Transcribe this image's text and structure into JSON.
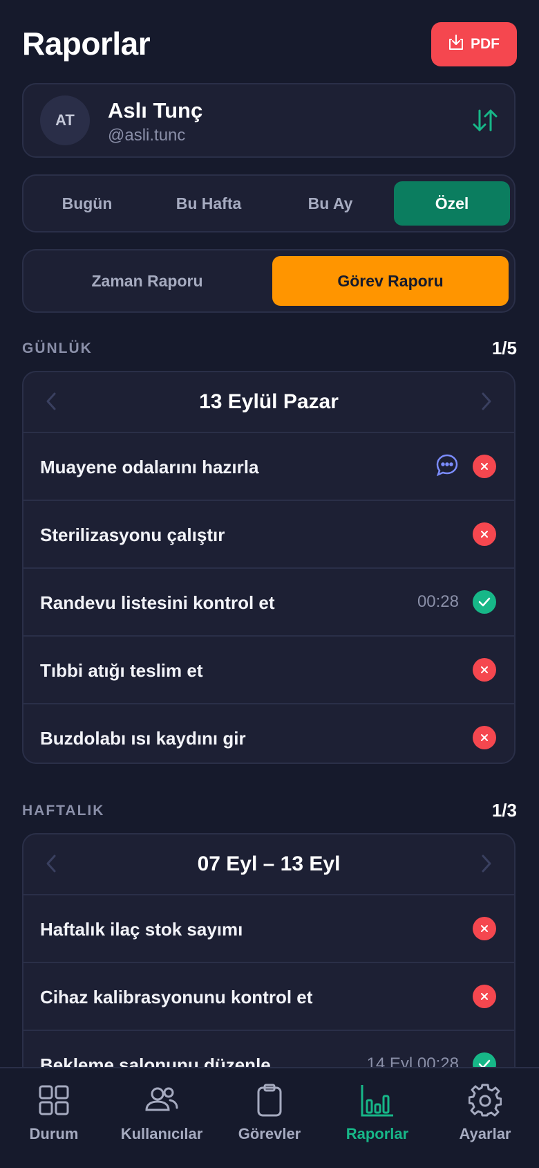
{
  "header": {
    "title": "Raporlar",
    "pdf_label": "PDF"
  },
  "user": {
    "initials": "AT",
    "name": "Aslı Tunç",
    "handle": "@asli.tunc"
  },
  "period_tabs": [
    "Bugün",
    "Bu Hafta",
    "Bu Ay",
    "Özel"
  ],
  "period_selected": "Özel",
  "report_tabs": [
    "Zaman Raporu",
    "Görev Raporu"
  ],
  "report_selected": "Görev Raporu",
  "daily": {
    "label": "GÜNLÜK",
    "page": "1/5",
    "date": "13 Eylül Pazar",
    "tasks": [
      {
        "title": "Muayene odalarını hazırla",
        "time": "",
        "status": "fail",
        "comment": true
      },
      {
        "title": "Sterilizasyonu çalıştır",
        "time": "",
        "status": "fail"
      },
      {
        "title": "Randevu listesini kontrol et",
        "time": "00:28",
        "status": "done"
      },
      {
        "title": "Tıbbi atığı teslim et",
        "time": "",
        "status": "fail"
      },
      {
        "title": "Buzdolabı ısı kaydını gir",
        "time": "",
        "status": "fail"
      }
    ]
  },
  "weekly": {
    "label": "HAFTALIK",
    "page": "1/3",
    "date": "07 Eyl – 13 Eyl",
    "tasks": [
      {
        "title": "Haftalık ilaç stok sayımı",
        "time": "",
        "status": "fail"
      },
      {
        "title": "Cihaz kalibrasyonunu kontrol et",
        "time": "",
        "status": "fail"
      },
      {
        "title": "Bekleme salonunu düzenle",
        "time": "14 Eyl 00:28",
        "status": "done"
      }
    ]
  },
  "colors": {
    "accent_green": "#17b788",
    "active_tab": "#0b7d5f",
    "orange": "#ff9500",
    "danger": "#f5474f",
    "background": "#161a2c",
    "card": "#1d2034"
  },
  "tabbar": [
    {
      "label": "Durum",
      "icon": "grid-icon"
    },
    {
      "label": "Kullanıcılar",
      "icon": "users-icon"
    },
    {
      "label": "Görevler",
      "icon": "clipboard-icon"
    },
    {
      "label": "Raporlar",
      "icon": "bar-chart-icon"
    },
    {
      "label": "Ayarlar",
      "icon": "gear-icon"
    }
  ],
  "tabbar_active": "Raporlar"
}
